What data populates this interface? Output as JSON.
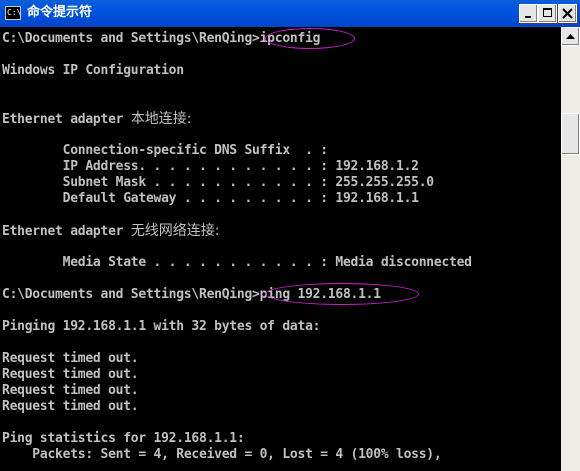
{
  "window": {
    "title": "命令提示符",
    "icon": "cmd-icon",
    "icon_text": "C:\\",
    "buttons": [
      "minimize-icon",
      "maximize-icon",
      "close-icon"
    ]
  },
  "console": {
    "lines": [
      {
        "text": "C:\\Documents and Settings\\RenQing>ipconfig"
      },
      {
        "text": ""
      },
      {
        "text": "Windows IP Configuration"
      },
      {
        "text": ""
      },
      {
        "text": ""
      },
      {
        "prefix": "Ethernet adapter ",
        "cn": "本地连接:"
      },
      {
        "text": ""
      },
      {
        "text": "        Connection-specific DNS Suffix  . :"
      },
      {
        "text": "        IP Address. . . . . . . . . . . . : 192.168.1.2"
      },
      {
        "text": "        Subnet Mask . . . . . . . . . . . : 255.255.255.0"
      },
      {
        "text": "        Default Gateway . . . . . . . . . : 192.168.1.1"
      },
      {
        "text": ""
      },
      {
        "prefix": "Ethernet adapter ",
        "cn": "无线网络连接:"
      },
      {
        "text": ""
      },
      {
        "text": "        Media State . . . . . . . . . . . : Media disconnected"
      },
      {
        "text": ""
      },
      {
        "text": "C:\\Documents and Settings\\RenQing>ping 192.168.1.1"
      },
      {
        "text": ""
      },
      {
        "text": "Pinging 192.168.1.1 with 32 bytes of data:"
      },
      {
        "text": ""
      },
      {
        "text": "Request timed out."
      },
      {
        "text": "Request timed out."
      },
      {
        "text": "Request timed out."
      },
      {
        "text": "Request timed out."
      },
      {
        "text": ""
      },
      {
        "text": "Ping statistics for 192.168.1.1:"
      },
      {
        "text": "    Packets: Sent = 4, Received = 0, Lost = 4 (100% loss),"
      }
    ],
    "highlight_color": "#d01fd0"
  },
  "colors": {
    "titlebar": "#0053e0",
    "console_bg": "#000000",
    "console_fg": "#c0c0c0"
  }
}
